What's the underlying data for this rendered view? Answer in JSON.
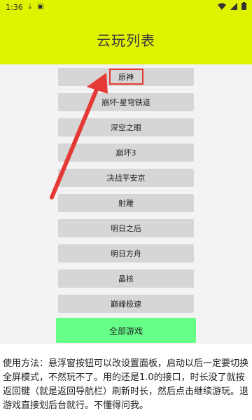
{
  "status_bar": {
    "time": "1:36",
    "bg": "#dff200"
  },
  "app_bar": {
    "title": "云玩列表"
  },
  "games": [
    {
      "label": "原神"
    },
    {
      "label": "崩坏·星穹铁道"
    },
    {
      "label": "深空之眼"
    },
    {
      "label": "崩坏3"
    },
    {
      "label": "决战平安京"
    },
    {
      "label": "射雕"
    },
    {
      "label": "明日之后"
    },
    {
      "label": "明日方舟"
    },
    {
      "label": "晶核"
    },
    {
      "label": "巅峰极速"
    }
  ],
  "all_games_button": {
    "label": "全部游戏",
    "color": "#66ff88"
  },
  "description": "使用方法：悬浮窗按钮可以改设置面板，启动以后一定要切换全屏模式，不然玩不了。用的还是1.0的接口，时长没了就按返回键（就是返回导航栏）刷新时长，然后点击继续游玩。退游戏直接划后台就行。不懂得问我。",
  "annotation_colors": {
    "highlight": "#e53935"
  }
}
